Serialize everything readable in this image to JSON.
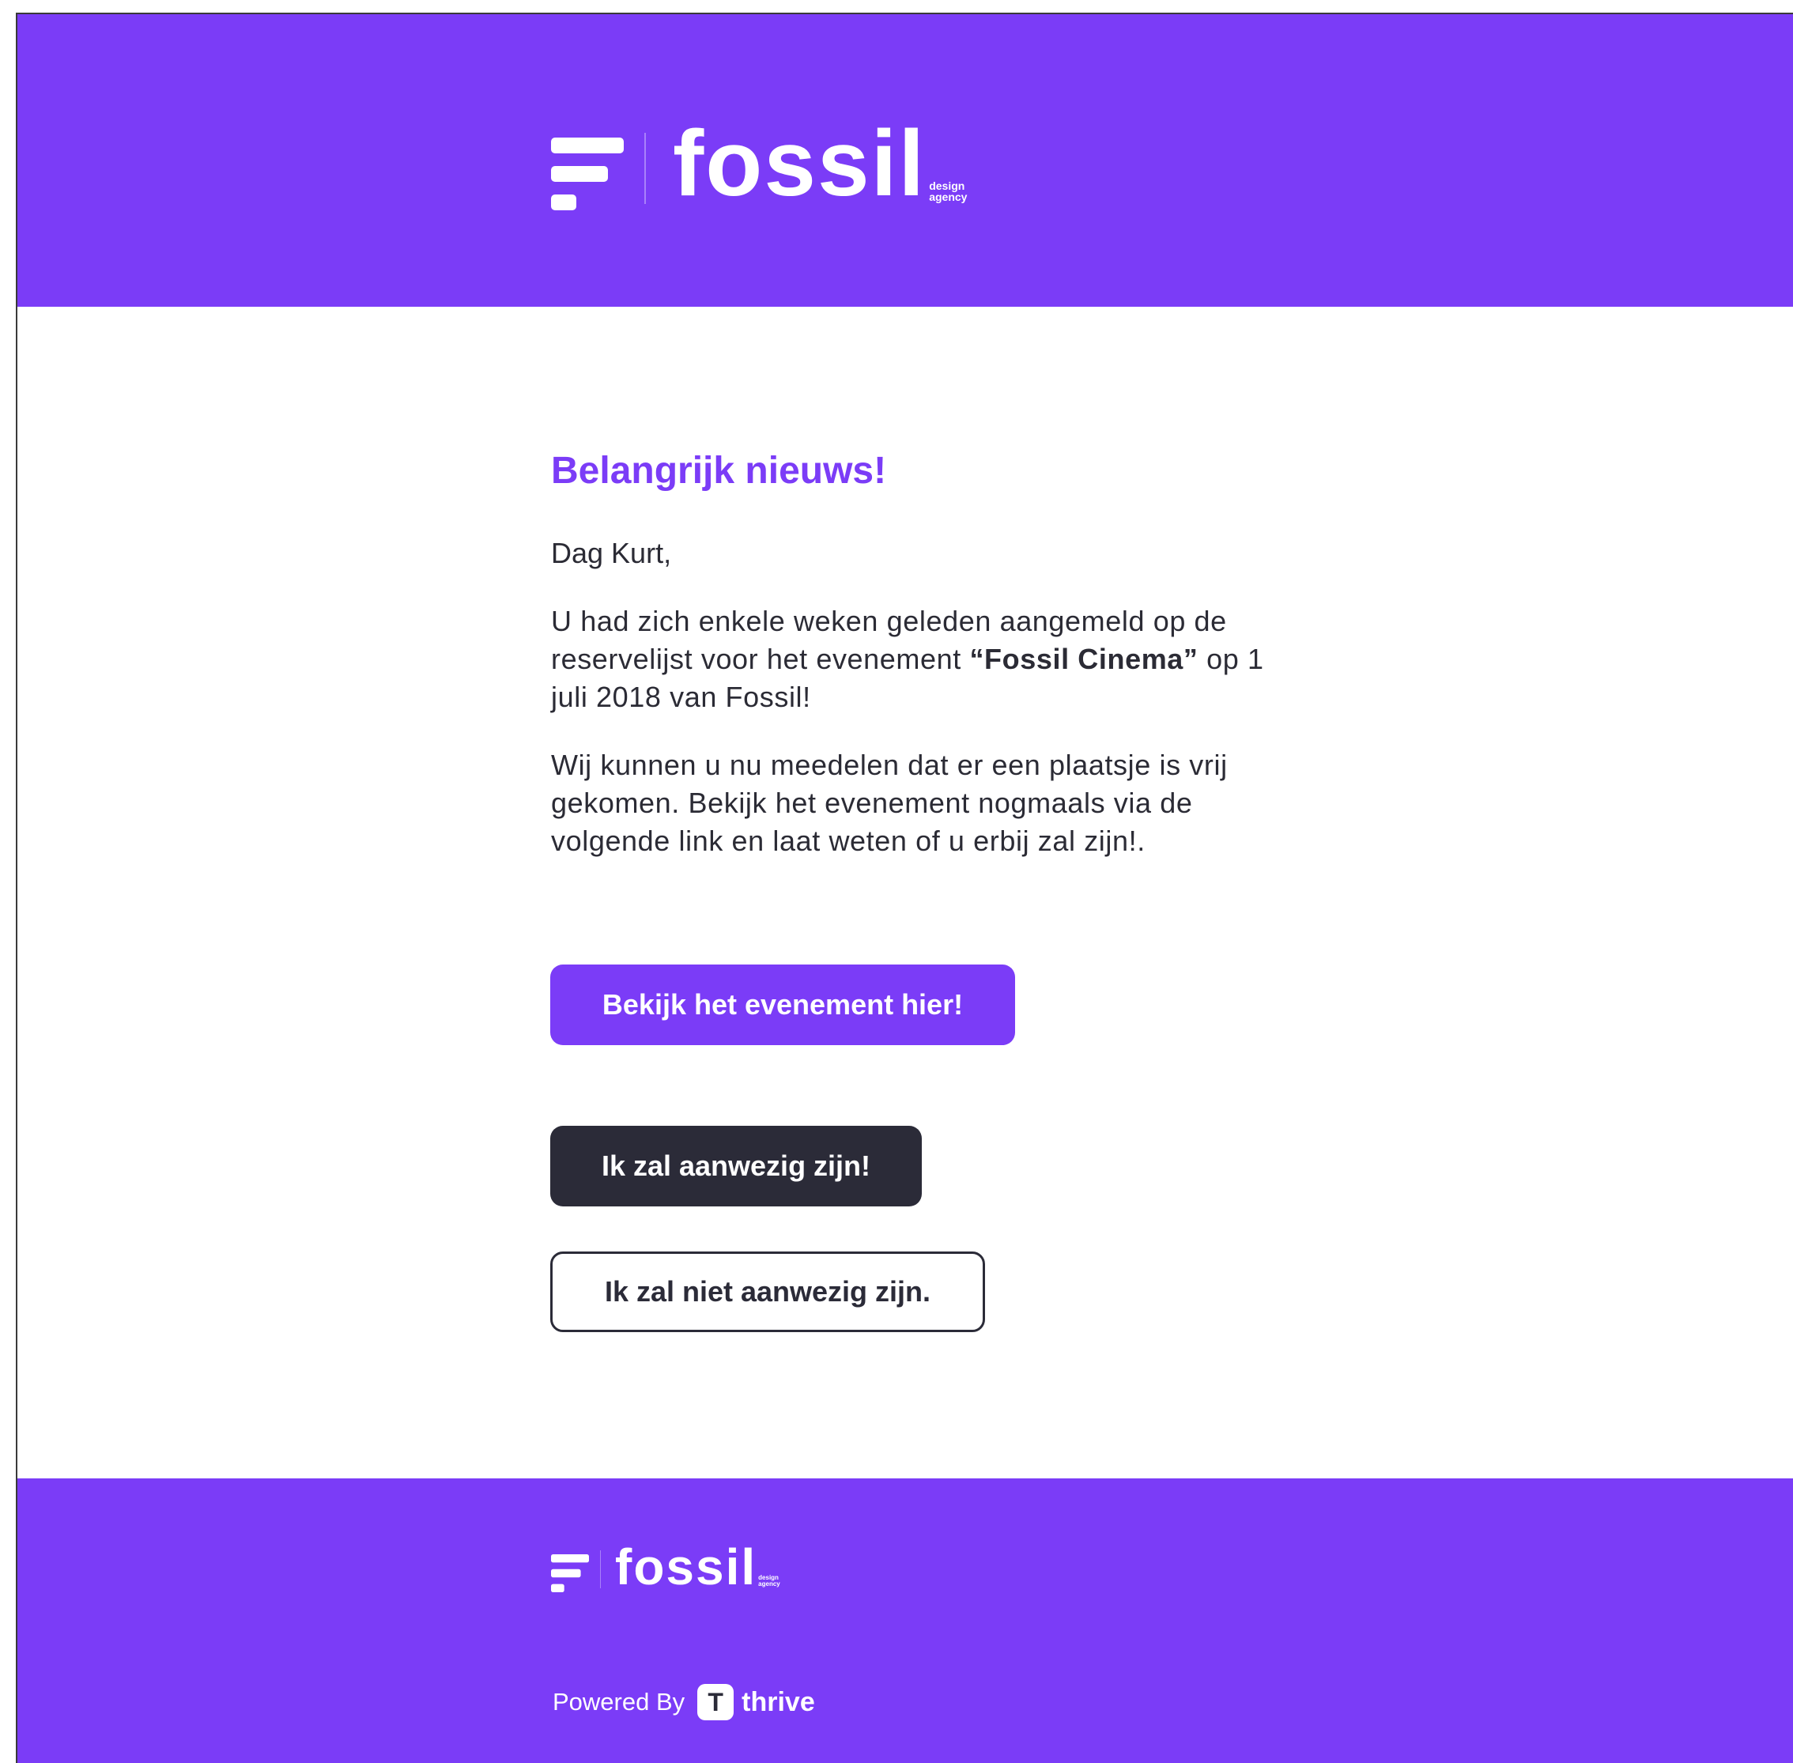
{
  "colors": {
    "brand_purple": "#7b3cf7",
    "dark": "#2b2b38",
    "white": "#ffffff"
  },
  "header": {
    "logo_word": "fossil",
    "logo_tag_line1": "design",
    "logo_tag_line2": "agency"
  },
  "content": {
    "title": "Belangrijk nieuws!",
    "greeting": "Dag Kurt,",
    "para1_before": "U had zich enkele weken geleden aangemeld op de reservelijst voor het evenement ",
    "para1_event": "“Fossil Cinema”",
    "para1_after": " op 1 juli 2018 van Fossil!",
    "para2": "Wij kunnen u nu meedelen dat er een plaatsje is vrij gekomen. Bekijk het evenement nogmaals via de volgende link en laat weten of u erbij zal zijn!."
  },
  "buttons": {
    "view_event": "Bekijk het evenement hier!",
    "attend": "Ik zal aanwezig zijn!",
    "not_attend": "Ik zal niet aanwezig zijn."
  },
  "footer": {
    "logo_word": "fossil",
    "logo_tag_line1": "design",
    "logo_tag_line2": "agency",
    "powered_by": "Powered By",
    "thrive_icon_letter": "T",
    "thrive_word": "thrive",
    "thrive_icon": "thrive-logo-icon"
  }
}
